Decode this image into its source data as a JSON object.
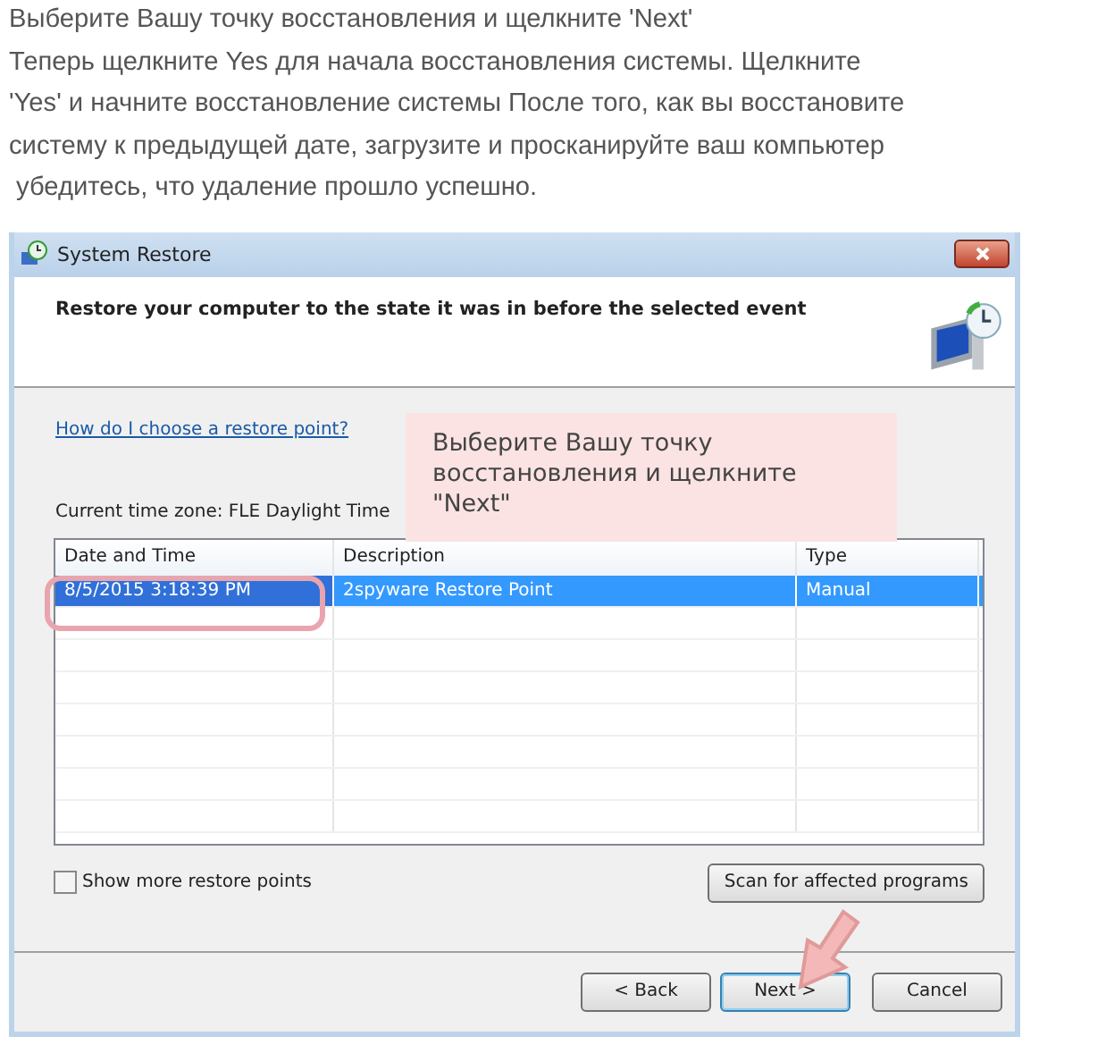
{
  "article": {
    "heading": "Выберите Вашу точку восстановления и щелкните 'Next'",
    "paragraph_lines": [
      "Теперь щелкните Yes для начала восстановления системы. Щелкните",
      "'Yes' и начните восстановление системы После того, как вы восстановите",
      "систему к предыдущей дате, загрузите и просканируйте ваш компьютер",
      "убедитесь, что удаление прошло успешно."
    ]
  },
  "window": {
    "title": "System Restore",
    "header": "Restore your computer to the state it was in before the selected event"
  },
  "help_link": "How do I choose a restore point?",
  "time_zone": "Current time zone: FLE Daylight Time",
  "table": {
    "columns": [
      "Date and Time",
      "Description",
      "Type"
    ],
    "rows": [
      {
        "cells": [
          "8/5/2015 3:18:39 PM",
          "2spyware Restore Point",
          "Manual"
        ],
        "selected": true
      }
    ]
  },
  "show_more": {
    "label": "Show more restore points",
    "checked": false
  },
  "scan_button": "Scan for affected programs",
  "buttons": [
    "< Back",
    "Next >",
    "Cancel"
  ],
  "callout": "Выберите Вашу точку восстановления и щелкните \"Next\""
}
